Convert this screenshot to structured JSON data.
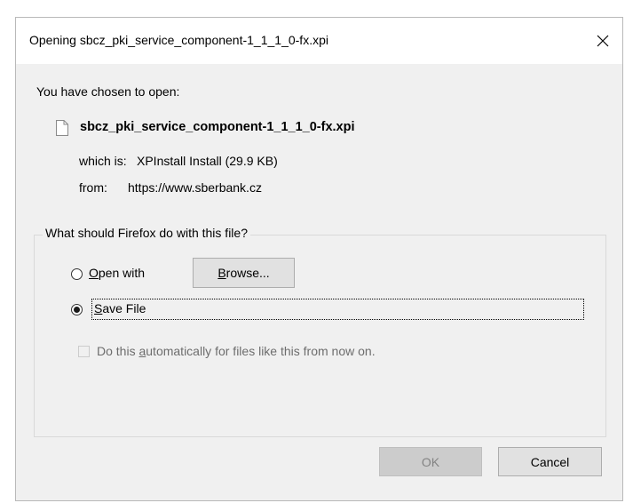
{
  "dialog": {
    "title": "Opening sbcz_pki_service_component-1_1_1_0-fx.xpi",
    "close_icon": "close-icon",
    "intro": "You have chosen to open:",
    "file": {
      "icon": "document-icon",
      "name": "sbcz_pki_service_component-1_1_1_0-fx.xpi",
      "which_is_label": "which is:",
      "which_is_value": "XPInstall Install (29.9 KB)",
      "from_label": "from:",
      "from_value": "https://www.sberbank.cz"
    },
    "action_group": {
      "legend": "What should Firefox do with this file?",
      "open_with": {
        "mnemonic": "O",
        "rest": "pen with",
        "selected": false
      },
      "browse_button": {
        "mnemonic": "B",
        "rest": "rowse..."
      },
      "save_file": {
        "mnemonic": "S",
        "rest": "ave File",
        "selected": true
      },
      "auto_checkbox": {
        "before": "Do this ",
        "mnemonic": "a",
        "after": "utomatically for files like this from now on.",
        "checked": false,
        "enabled": false
      }
    },
    "buttons": {
      "ok": "OK",
      "cancel": "Cancel"
    }
  }
}
